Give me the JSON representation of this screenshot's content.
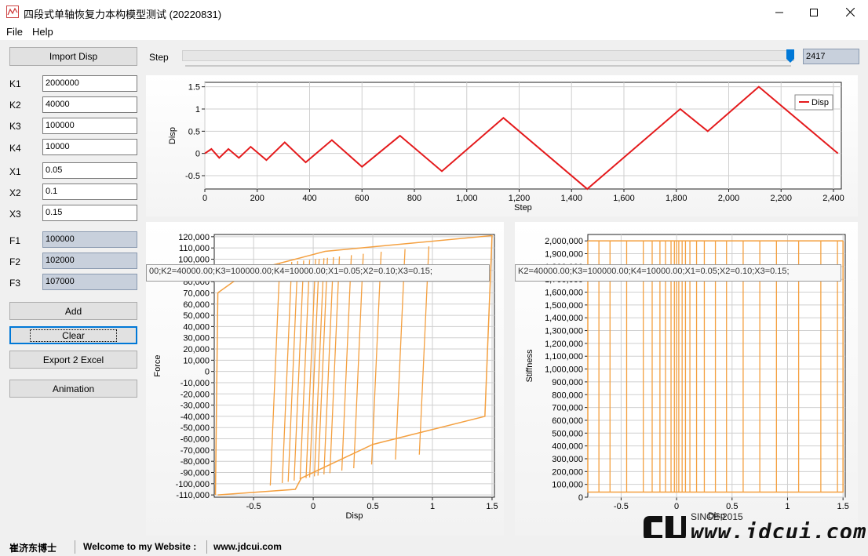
{
  "window": {
    "title": "四段式单轴恢复力本构模型测试 (20220831)",
    "menu": [
      "File",
      "Help"
    ]
  },
  "left_panel": {
    "import_label": "Import Disp",
    "params": [
      {
        "label": "K1",
        "value": "2000000"
      },
      {
        "label": "K2",
        "value": "40000"
      },
      {
        "label": "K3",
        "value": "100000"
      },
      {
        "label": "K4",
        "value": "10000"
      },
      {
        "label": "X1",
        "value": "0.05"
      },
      {
        "label": "X2",
        "value": "0.1"
      },
      {
        "label": "X3",
        "value": "0.15"
      }
    ],
    "forces": [
      {
        "label": "F1",
        "value": "100000"
      },
      {
        "label": "F2",
        "value": "102000"
      },
      {
        "label": "F3",
        "value": "107000"
      }
    ],
    "add_label": "Add",
    "clear_label": "Clear",
    "export_label": "Export 2 Excel",
    "animation_label": "Animation"
  },
  "step": {
    "label": "Step",
    "value": "2417",
    "fraction": 0.995
  },
  "tooltip_force": "00;K2=40000.00;K3=100000.00;K4=10000.00;X1=0.05;X2=0.10;X3=0.15;",
  "tooltip_stiffness": "K2=40000.00;K3=100000.00;K4=10000.00;X1=0.05;X2=0.10;X3=0.15;",
  "watermark": {
    "since": "SINCE 2015",
    "url": "www.jdcui.com"
  },
  "statusbar": {
    "author": "崔济东博士",
    "welcome": "Welcome to my Website :",
    "site": "www.jdcui.com"
  },
  "colors": {
    "disp_line": "#e41a1c",
    "hysteresis": "#f4a040"
  },
  "chart_data": [
    {
      "type": "line",
      "xlabel": "Step",
      "ylabel": "Disp",
      "xlim": [
        0,
        2430
      ],
      "ylim": [
        -0.8,
        1.6
      ],
      "xticks": [
        "0",
        "200",
        "400",
        "600",
        "800",
        "1,000",
        "1,200",
        "1,400",
        "1,600",
        "1,800",
        "2,000",
        "2,200",
        "2,400"
      ],
      "yticks": [
        "-0.5",
        "0",
        "0.5",
        "1",
        "1.5"
      ],
      "legend": "top-right",
      "series": [
        {
          "name": "Disp",
          "x": [
            0,
            25,
            55,
            90,
            130,
            175,
            235,
            305,
            385,
            485,
            600,
            745,
            905,
            1140,
            1460,
            1815,
            1920,
            2115,
            2417
          ],
          "y": [
            0,
            0.1,
            -0.1,
            0.1,
            -0.1,
            0.15,
            -0.15,
            0.25,
            -0.2,
            0.3,
            -0.3,
            0.4,
            -0.4,
            0.8,
            -0.8,
            1.0,
            0.5,
            1.5,
            0
          ]
        }
      ]
    },
    {
      "type": "line",
      "xlabel": "Disp",
      "ylabel": "Force",
      "xlim": [
        -0.83,
        1.52
      ],
      "ylim": [
        -112000,
        122000
      ],
      "xticks": [
        "-0.5",
        "0",
        "0.5",
        "1",
        "1.5"
      ],
      "yticks": [
        "-110,000",
        "-100,000",
        "-90,000",
        "-80,000",
        "-70,000",
        "-60,000",
        "-50,000",
        "-40,000",
        "-30,000",
        "-20,000",
        "-10,000",
        "0",
        "10,000",
        "20,000",
        "30,000",
        "40,000",
        "50,000",
        "60,000",
        "70,000",
        "80,000",
        "90,000",
        "100,000",
        "110,000",
        "120,000"
      ],
      "series": [
        {
          "name": "",
          "x": [
            -0.82,
            -0.8,
            -0.55,
            -0.15,
            0.1,
            1.5,
            1.44,
            0.5,
            0.1,
            -0.1,
            -0.15,
            -0.8
          ],
          "y": [
            -110000,
            70000,
            89000,
            100000,
            107000,
            121000,
            -40000,
            -65000,
            -85000,
            -95000,
            -105000,
            -110000
          ]
        }
      ]
    },
    {
      "type": "line",
      "xlabel": "Disp",
      "ylabel": "Stiffness",
      "xlim": [
        -0.8,
        1.52
      ],
      "ylim": [
        0,
        2050000
      ],
      "xticks": [
        "-0.5",
        "0",
        "0.5",
        "1",
        "1.5"
      ],
      "yticks": [
        "0",
        "100,000",
        "200,000",
        "300,000",
        "400,000",
        "500,000",
        "600,000",
        "700,000",
        "800,000",
        "900,000",
        "1,000,000",
        "1,100,000",
        "1,200,000",
        "1,300,000",
        "1,400,000",
        "1,500,000",
        "1,600,000",
        "1,700,000",
        "1,800,000",
        "1,900,000",
        "2,000,000"
      ],
      "series": [
        {
          "name": "",
          "x": [
            -0.8,
            -0.8,
            1.5,
            1.5
          ],
          "y": [
            2000000,
            40000,
            40000,
            2000000
          ]
        }
      ]
    }
  ]
}
